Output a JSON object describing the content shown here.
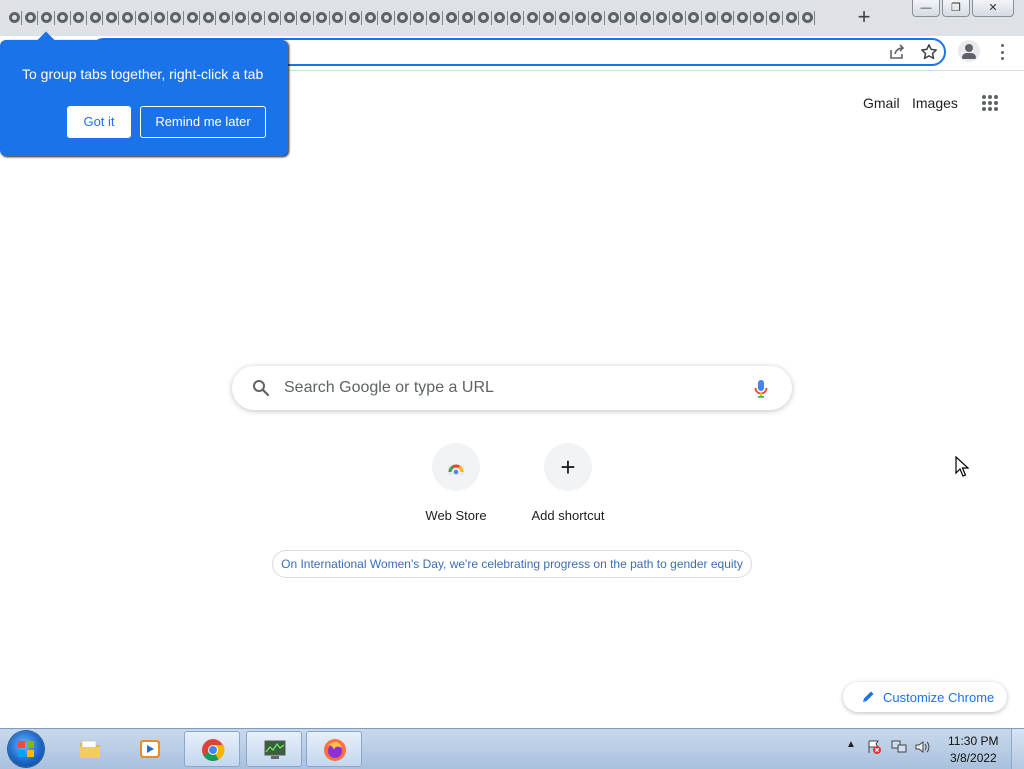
{
  "browser": {
    "tab_count": 50,
    "new_tab_label": "+",
    "window_controls": {
      "minimize": "—",
      "restore": "❐",
      "close": "✕"
    }
  },
  "tooltip": {
    "message": "To group tabs together, right-click a tab",
    "got_it": "Got it",
    "remind_later": "Remind me later"
  },
  "ntp": {
    "gmail": "Gmail",
    "images": "Images",
    "search_placeholder": "Search Google or type a URL",
    "shortcuts": [
      {
        "label": "Web Store",
        "icon": "webstore-icon"
      },
      {
        "label": "Add shortcut",
        "icon": "plus-icon"
      }
    ],
    "doodle_share": "On International Women's Day, we're celebrating progress on the path to gender equity",
    "customize": "Customize Chrome"
  },
  "taskbar": {
    "items": [
      {
        "name": "file-explorer",
        "icon": "folder-icon"
      },
      {
        "name": "media-player",
        "icon": "media-player-icon"
      },
      {
        "name": "chrome",
        "icon": "chrome-icon",
        "active": true
      },
      {
        "name": "task-manager",
        "icon": "monitor-icon",
        "active": true
      },
      {
        "name": "firefox",
        "icon": "firefox-icon",
        "active": true
      }
    ],
    "time": "11:30 PM",
    "date": "3/8/2022"
  },
  "colors": {
    "accent": "#1a73e8",
    "tabstrip": "#dee1e6",
    "taskbar": "#b9cde6"
  }
}
